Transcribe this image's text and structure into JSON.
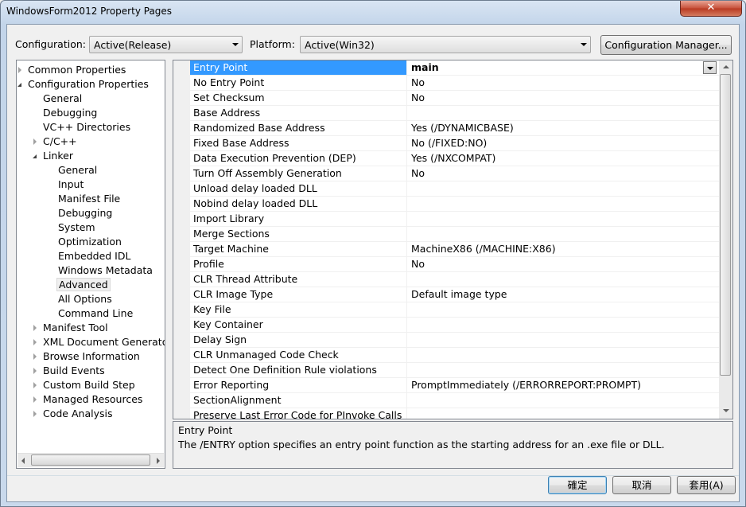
{
  "window": {
    "title": "WindowsForm2012 Property Pages",
    "close_glyph": "✕"
  },
  "toolbar": {
    "configuration_label": "Configuration:",
    "configuration_value": "Active(Release)",
    "platform_label": "Platform:",
    "platform_value": "Active(Win32)",
    "config_manager_label": "Configuration Manager..."
  },
  "tree": {
    "items": [
      {
        "label": "Common Properties",
        "level": 0,
        "toggle": "closed"
      },
      {
        "label": "Configuration Properties",
        "level": 0,
        "toggle": "open"
      },
      {
        "label": "General",
        "level": 1,
        "toggle": "none"
      },
      {
        "label": "Debugging",
        "level": 1,
        "toggle": "none"
      },
      {
        "label": "VC++ Directories",
        "level": 1,
        "toggle": "none"
      },
      {
        "label": "C/C++",
        "level": 1,
        "toggle": "closed"
      },
      {
        "label": "Linker",
        "level": 1,
        "toggle": "open"
      },
      {
        "label": "General",
        "level": 2,
        "toggle": "none"
      },
      {
        "label": "Input",
        "level": 2,
        "toggle": "none"
      },
      {
        "label": "Manifest File",
        "level": 2,
        "toggle": "none"
      },
      {
        "label": "Debugging",
        "level": 2,
        "toggle": "none"
      },
      {
        "label": "System",
        "level": 2,
        "toggle": "none"
      },
      {
        "label": "Optimization",
        "level": 2,
        "toggle": "none"
      },
      {
        "label": "Embedded IDL",
        "level": 2,
        "toggle": "none"
      },
      {
        "label": "Windows Metadata",
        "level": 2,
        "toggle": "none"
      },
      {
        "label": "Advanced",
        "level": 2,
        "toggle": "none",
        "selected": true
      },
      {
        "label": "All Options",
        "level": 2,
        "toggle": "none"
      },
      {
        "label": "Command Line",
        "level": 2,
        "toggle": "none"
      },
      {
        "label": "Manifest Tool",
        "level": 1,
        "toggle": "closed"
      },
      {
        "label": "XML Document Generator",
        "level": 1,
        "toggle": "closed"
      },
      {
        "label": "Browse Information",
        "level": 1,
        "toggle": "closed"
      },
      {
        "label": "Build Events",
        "level": 1,
        "toggle": "closed"
      },
      {
        "label": "Custom Build Step",
        "level": 1,
        "toggle": "closed"
      },
      {
        "label": "Managed Resources",
        "level": 1,
        "toggle": "closed"
      },
      {
        "label": "Code Analysis",
        "level": 1,
        "toggle": "closed"
      }
    ]
  },
  "grid": {
    "properties": [
      {
        "name": "Entry Point",
        "value": "main",
        "selected": true
      },
      {
        "name": "No Entry Point",
        "value": "No"
      },
      {
        "name": "Set Checksum",
        "value": "No"
      },
      {
        "name": "Base Address",
        "value": ""
      },
      {
        "name": "Randomized Base Address",
        "value": "Yes (/DYNAMICBASE)"
      },
      {
        "name": "Fixed Base Address",
        "value": "No (/FIXED:NO)"
      },
      {
        "name": "Data Execution Prevention (DEP)",
        "value": "Yes (/NXCOMPAT)"
      },
      {
        "name": "Turn Off Assembly Generation",
        "value": "No"
      },
      {
        "name": "Unload delay loaded DLL",
        "value": ""
      },
      {
        "name": "Nobind delay loaded DLL",
        "value": ""
      },
      {
        "name": "Import Library",
        "value": ""
      },
      {
        "name": "Merge Sections",
        "value": ""
      },
      {
        "name": "Target Machine",
        "value": "MachineX86 (/MACHINE:X86)"
      },
      {
        "name": "Profile",
        "value": "No"
      },
      {
        "name": "CLR Thread Attribute",
        "value": ""
      },
      {
        "name": "CLR Image Type",
        "value": "Default image type"
      },
      {
        "name": "Key File",
        "value": ""
      },
      {
        "name": "Key Container",
        "value": ""
      },
      {
        "name": "Delay Sign",
        "value": ""
      },
      {
        "name": "CLR Unmanaged Code Check",
        "value": ""
      },
      {
        "name": "Detect One Definition Rule violations",
        "value": ""
      },
      {
        "name": "Error Reporting",
        "value": "PromptImmediately (/ERRORREPORT:PROMPT)"
      },
      {
        "name": "SectionAlignment",
        "value": ""
      },
      {
        "name": "Preserve Last Error Code for PInvoke Calls",
        "value": ""
      }
    ]
  },
  "description": {
    "title": "Entry Point",
    "text": "The /ENTRY option specifies an entry point function as the starting address for an .exe file or DLL."
  },
  "footer": {
    "ok_label": "確定",
    "cancel_label": "取消",
    "apply_label": "套用(A)"
  },
  "colors": {
    "selection": "#3399ff",
    "window_frame": "#c9d9ec"
  }
}
